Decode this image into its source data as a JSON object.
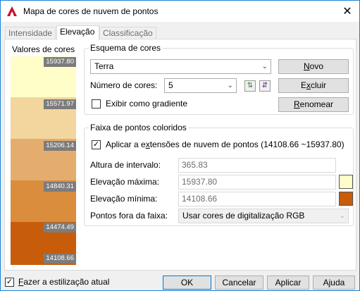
{
  "window": {
    "title": "Mapa de cores de nuvem de pontos",
    "app_icon": "autocad-logo-icon",
    "accent": "#1883d7"
  },
  "tabs": [
    {
      "label": "Intensidade",
      "active": false
    },
    {
      "label": "Elevação",
      "active": true
    },
    {
      "label": "Classificação",
      "active": false
    }
  ],
  "color_values": {
    "label": "Valores de cores",
    "bands": [
      {
        "color": "#fffec8"
      },
      {
        "color": "#f2d69e"
      },
      {
        "color": "#e5ad6d"
      },
      {
        "color": "#d98d3d"
      },
      {
        "color": "#c75c0b"
      }
    ],
    "ticks": [
      "15937.80",
      "15571.97",
      "15206.14",
      "14840.31",
      "14474.49",
      "14108.66"
    ]
  },
  "scheme": {
    "group_label": "Esquema de cores",
    "selected": "Terra",
    "num_colors_label": "Número de cores:",
    "num_colors": "5",
    "gradient_label": "Exibir como gradiente",
    "gradient_checked": false,
    "buttons": {
      "new": {
        "prefix": "",
        "hotkey": "N",
        "rest": "ovo"
      },
      "delete": {
        "prefix": "E",
        "hotkey": "x",
        "rest": "cluir"
      },
      "rename": {
        "prefix": "",
        "hotkey": "R",
        "rest": "enomear"
      }
    }
  },
  "range": {
    "group_label": "Faixa de pontos coloridos",
    "apply_label_prefix": "Aplicar a e",
    "apply_label_hotkey": "x",
    "apply_label_rest": "tensões de nuvem de pontos",
    "apply_range": "(14108.66 ~15937.80)",
    "apply_checked": true,
    "interval_label": "Altura de intervalo:",
    "interval_value": "365.83",
    "max_label": "Elevação máxima:",
    "max_value": "15937.80",
    "max_color": "#fffec8",
    "min_label": "Elevação mínima:",
    "min_value": "14108.66",
    "min_color": "#c75c0b",
    "outside_label": "Pontos fora da faixa:",
    "outside_value": "Usar cores de digitalização RGB"
  },
  "footer": {
    "current_style_prefix": "",
    "current_style_hotkey": "F",
    "current_style_rest": "azer a estilização atual",
    "current_style_checked": true,
    "ok": "OK",
    "cancel": "Cancelar",
    "apply": "Aplicar",
    "help": "Ajuda"
  }
}
